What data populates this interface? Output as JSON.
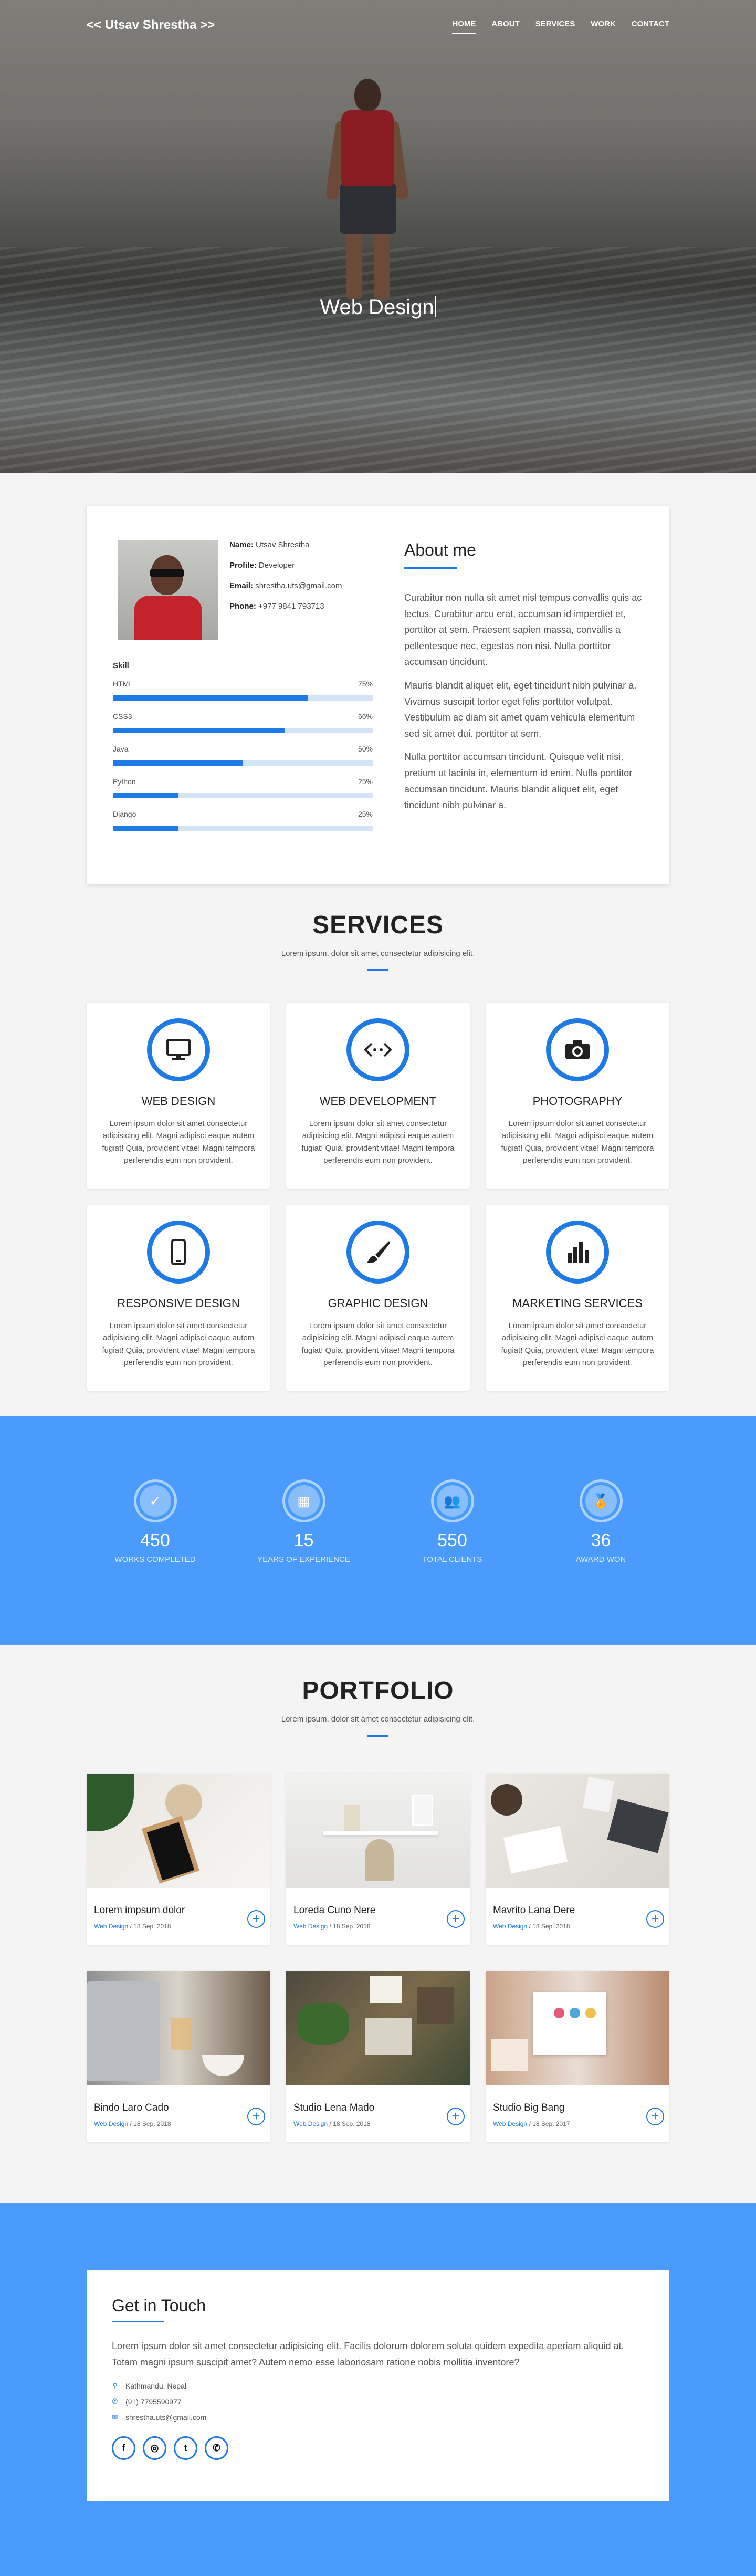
{
  "nav": {
    "brand": "<< Utsav Shrestha >>",
    "items": [
      {
        "label": "HOME",
        "active": true
      },
      {
        "label": "ABOUT"
      },
      {
        "label": "SERVICES"
      },
      {
        "label": "WORK"
      },
      {
        "label": "CONTACT"
      }
    ]
  },
  "hero": {
    "typed_text": "Web Design"
  },
  "about": {
    "info": [
      {
        "key": "Name:",
        "value": "Utsav Shrestha"
      },
      {
        "key": "Profile:",
        "value": "Developer"
      },
      {
        "key": "Email:",
        "value": "shrestha.uts@gmail.com"
      },
      {
        "key": "Phone:",
        "value": "+977 9841 793713"
      }
    ],
    "skill_heading": "Skill",
    "skills": [
      {
        "name": "HTML",
        "pct": "75%",
        "value": 75
      },
      {
        "name": "CSS3",
        "pct": "66%",
        "value": 66
      },
      {
        "name": "Java",
        "pct": "50%",
        "value": 50
      },
      {
        "name": "Python",
        "pct": "25%",
        "value": 25
      },
      {
        "name": "Django",
        "pct": "25%",
        "value": 25
      }
    ],
    "title": "About me",
    "paragraphs": [
      "Curabitur non nulla sit amet nisl tempus convallis quis ac lectus. Curabitur arcu erat, accumsan id imperdiet et, porttitor at sem. Praesent sapien massa, convallis a pellentesque nec, egestas non nisi. Nulla porttitor accumsan tincidunt.",
      "Mauris blandit aliquet elit, eget tincidunt nibh pulvinar a. Vivamus suscipit tortor eget felis porttitor volutpat. Vestibulum ac diam sit amet quam vehicula elementum sed sit amet dui. porttitor at sem.",
      "Nulla porttitor accumsan tincidunt. Quisque velit nisi, pretium ut lacinia in, elementum id enim. Nulla porttitor accumsan tincidunt. Mauris blandit aliquet elit, eget tincidunt nibh pulvinar a."
    ]
  },
  "services": {
    "title": "SERVICES",
    "subtitle": "Lorem ipsum, dolor sit amet consectetur adipisicing elit.",
    "items": [
      {
        "icon": "monitor-icon",
        "title": "WEB DESIGN",
        "text": "Lorem ipsum dolor sit amet consectetur adipisicing elit. Magni adipisci eaque autem fugiat! Quia, provident vitae! Magni tempora perferendis eum non provident."
      },
      {
        "icon": "code-icon",
        "title": "WEB DEVELOPMENT",
        "text": "Lorem ipsum dolor sit amet consectetur adipisicing elit. Magni adipisci eaque autem fugiat! Quia, provident vitae! Magni tempora perferendis eum non provident."
      },
      {
        "icon": "camera-icon",
        "title": "PHOTOGRAPHY",
        "text": "Lorem ipsum dolor sit amet consectetur adipisicing elit. Magni adipisci eaque autem fugiat! Quia, provident vitae! Magni tempora perferendis eum non provident."
      },
      {
        "icon": "mobile-icon",
        "title": "RESPONSIVE DESIGN",
        "text": "Lorem ipsum dolor sit amet consectetur adipisicing elit. Magni adipisci eaque autem fugiat! Quia, provident vitae! Magni tempora perferendis eum non provident."
      },
      {
        "icon": "brush-icon",
        "title": "GRAPHIC DESIGN",
        "text": "Lorem ipsum dolor sit amet consectetur adipisicing elit. Magni adipisci eaque autem fugiat! Quia, provident vitae! Magni tempora perferendis eum non provident."
      },
      {
        "icon": "bar-chart-icon",
        "title": "MARKETING SERVICES",
        "text": "Lorem ipsum dolor sit amet consectetur adipisicing elit. Magni adipisci eaque autem fugiat! Quia, provident vitae! Magni tempora perferendis eum non provident."
      }
    ]
  },
  "stats": [
    {
      "icon": "check-icon",
      "number": "450",
      "label": "WORKS COMPLETED"
    },
    {
      "icon": "calendar-icon",
      "number": "15",
      "label": "YEARS OF EXPERIENCE"
    },
    {
      "icon": "users-icon",
      "number": "550",
      "label": "TOTAL CLIENTS"
    },
    {
      "icon": "award-icon",
      "number": "36",
      "label": "AWARD WON"
    }
  ],
  "portfolio": {
    "title": "PORTFOLIO",
    "subtitle": "Lorem ipsum, dolor sit amet consectetur adipisicing elit.",
    "items": [
      {
        "title": "Lorem impsum dolor",
        "category": "Web Design",
        "date": " / 18 Sep. 2018"
      },
      {
        "title": "Loreda Cuno Nere",
        "category": "Web Design",
        "date": " / 18 Sep. 2018"
      },
      {
        "title": "Mavrito Lana Dere",
        "category": "Web Design",
        "date": " / 18 Sep. 2018"
      },
      {
        "title": "Bindo Laro Cado",
        "category": "Web Design",
        "date": " / 18 Sep. 2018"
      },
      {
        "title": "Studio Lena Mado",
        "category": "Web Design",
        "date": " / 18 Sep. 2018"
      },
      {
        "title": "Studio Big Bang",
        "category": "Web Design",
        "date": " / 18 Sep. 2017"
      }
    ]
  },
  "contact": {
    "title": "Get in Touch",
    "text": "Lorem ipsum dolor sit amet consectetur adipisicing elit. Facilis dolorum dolorem soluta quidem expedita aperiam aliquid at. Totam magni ipsum suscipit amet? Autem nemo esse laboriosam ratione nobis mollitia inventore?",
    "location": "Kathmandu, Nepal",
    "phone": "(91) 7795590977",
    "email": "shrestha.uts@gmail.com",
    "socials": [
      {
        "icon": "facebook-icon",
        "glyph": "f"
      },
      {
        "icon": "instagram-icon",
        "glyph": "◎"
      },
      {
        "icon": "twitter-icon",
        "glyph": "t"
      },
      {
        "icon": "whatsapp-icon",
        "glyph": "✆"
      }
    ]
  },
  "colors": {
    "accent": "#1e7be6",
    "band": "#4a9bfc"
  }
}
